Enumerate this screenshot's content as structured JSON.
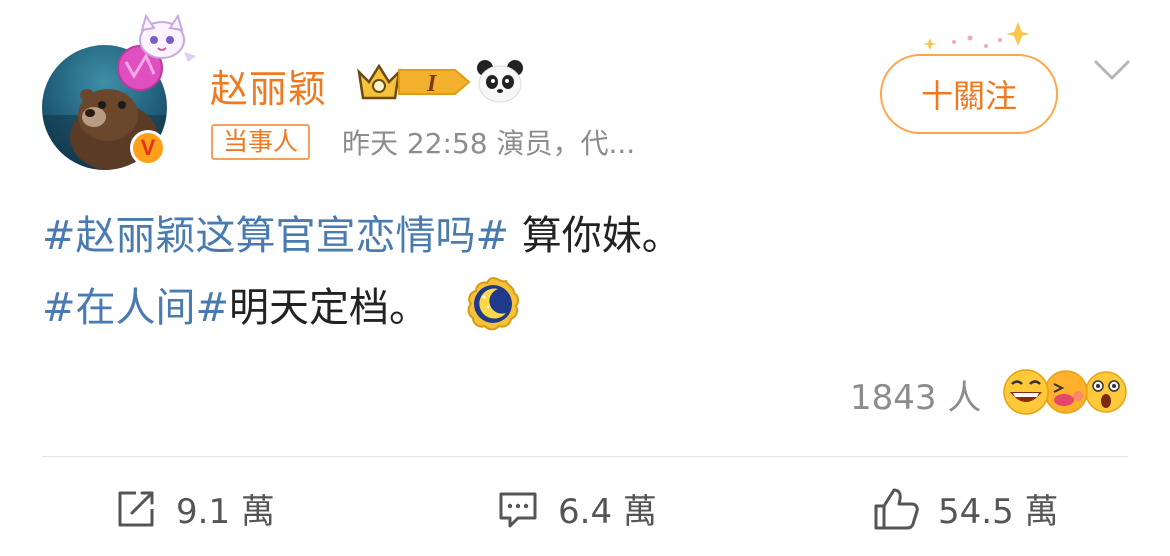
{
  "post": {
    "author": {
      "name": "赵丽颖",
      "tag": "当事人",
      "badge_level": "I",
      "verified_mark": "V"
    },
    "meta": "昨天 22:58  演员，代...",
    "follow_label": "十關注",
    "content": {
      "hashtag1": "#赵丽颖这算官宣恋情吗#",
      "text1": " 算你妹。",
      "hashtag2": "#在人间#",
      "text2": "明天定档。"
    },
    "reactions": {
      "count": "1843 人"
    },
    "actions": {
      "repost": "9.1 萬",
      "comment": "6.4 萬",
      "like": "54.5 萬"
    }
  },
  "colors": {
    "username": "#f0781f",
    "hashtag": "#4a7bb0",
    "follow_border": "#ffa54a",
    "meta": "#8c8c8c"
  },
  "icons": [
    "avatar",
    "cat-pendant-icon",
    "verified-icon",
    "crown-badge-icon",
    "panda-icon",
    "chevron-down-icon",
    "moon-emoji-icon",
    "reaction-emojis-icon",
    "repost-icon",
    "comment-icon",
    "like-icon"
  ]
}
